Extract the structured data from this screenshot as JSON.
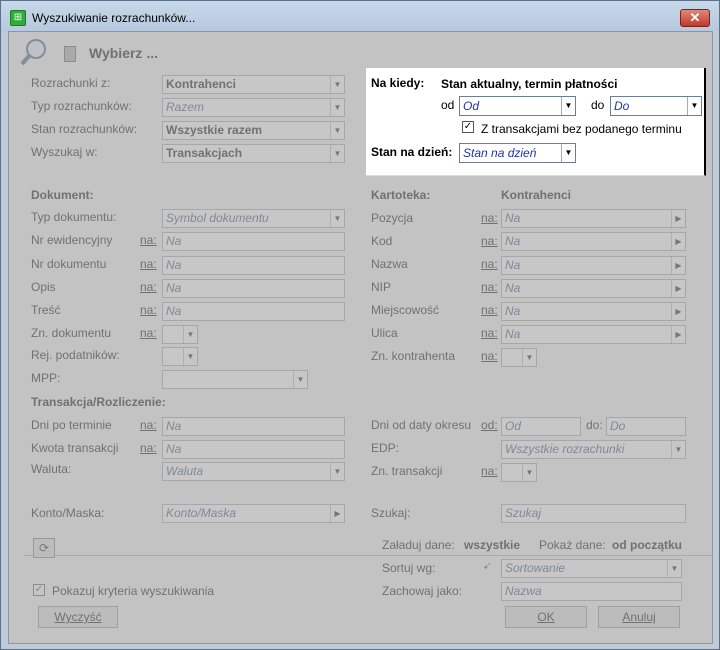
{
  "window": {
    "title": "Wyszukiwanie rozrachunków..."
  },
  "toolbar": {
    "choose_label": "Wybierz ..."
  },
  "left_top": {
    "rozrachunki_label": "Rozrachunki z:",
    "rozrachunki_value": "Kontrahenci",
    "typ_label": "Typ rozrachunków:",
    "typ_value": "Razem",
    "stan_label": "Stan rozrachunków:",
    "stan_value": "Wszystkie razem",
    "wyszukaj_label": "Wyszukaj w:",
    "wyszukaj_value": "Transakcjach"
  },
  "popup": {
    "na_kiedy_label": "Na kiedy:",
    "na_kiedy_value": "Stan aktualny, termin płatności",
    "od_label": "od",
    "od_value": "Od",
    "do_label": "do",
    "do_value": "Do",
    "checkbox_label": "Z transakcjami bez podanego terminu",
    "stan_na_dzien_label": "Stan na dzień:",
    "stan_na_dzien_value": "Stan na dzień"
  },
  "dokument": {
    "header": "Dokument:",
    "typ_label": "Typ dokumentu:",
    "typ_placeholder": "Symbol dokumentu",
    "nr_ewid_label": "Nr ewidencyjny",
    "nr_dok_label": "Nr dokumentu",
    "opis_label": "Opis",
    "tresc_label": "Treść",
    "zn_label": "Zn. dokumentu",
    "rej_label": "Rej. podatników:",
    "mpp_label": "MPP:",
    "na": "na:",
    "na_placeholder": "Na"
  },
  "kartoteka": {
    "header": "Kartoteka:",
    "value": "Kontrahenci",
    "pozycja": "Pozycja",
    "kod": "Kod",
    "nazwa": "Nazwa",
    "nip": "NIP",
    "miejscowosc": "Miejscowość",
    "ulica": "Ulica",
    "zn_kontrahenta": "Zn. kontrahenta"
  },
  "transakcja": {
    "header": "Transakcja/Rozliczenie:",
    "dni_label": "Dni po terminie",
    "kwota_label": "Kwota transakcji",
    "waluta_label": "Waluta:",
    "waluta_placeholder": "Waluta",
    "dni_od_label": "Dni od daty okresu",
    "od_link": "od:",
    "od_placeholder": "Od",
    "do_label": "do:",
    "do_placeholder": "Do",
    "edp_label": "EDP:",
    "edp_value": "Wszystkie rozrachunki",
    "zn_trans_label": "Zn. transakcji"
  },
  "konto": {
    "label": "Konto/Maska:",
    "placeholder": "Konto/Maska",
    "szukaj_label": "Szukaj:",
    "szukaj_placeholder": "Szukaj"
  },
  "bottom": {
    "zaladuj_label": "Załaduj dane:",
    "zaladuj_value": "wszystkie",
    "pokaz_label": "Pokaż dane:",
    "pokaz_value": "od początku",
    "sortuj_label": "Sortuj wg:",
    "sortuj_placeholder": "Sortowanie",
    "zachowaj_label": "Zachowaj jako:",
    "zachowaj_placeholder": "Nazwa",
    "pokazuj_label": "Pokazuj kryteria wyszukiwania",
    "wyczysc": "Wyczyść",
    "ok": "OK",
    "anuluj": "Anuluj"
  }
}
